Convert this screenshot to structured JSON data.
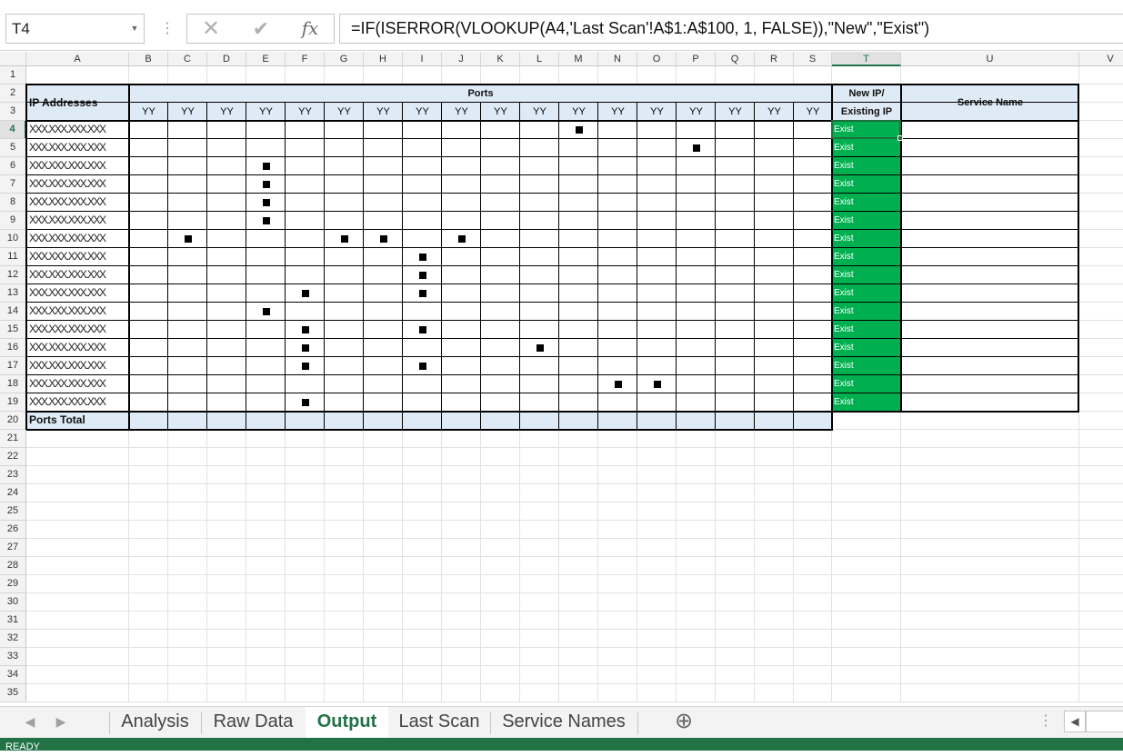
{
  "formula_bar": {
    "name_box": "T4",
    "formula": "=IF(ISERROR(VLOOKUP(A4,'Last Scan'!A$1:A$100, 1, FALSE)),\"New\",\"Exist\")",
    "cancel_icon": "close-icon",
    "enter_icon": "check-icon",
    "fx_label": "fx"
  },
  "columns": [
    "A",
    "B",
    "C",
    "D",
    "E",
    "F",
    "G",
    "H",
    "I",
    "J",
    "K",
    "L",
    "M",
    "N",
    "O",
    "P",
    "Q",
    "R",
    "S",
    "T",
    "U",
    "V"
  ],
  "rows": [
    "1",
    "2",
    "3",
    "4",
    "5",
    "6",
    "7",
    "8",
    "9",
    "10",
    "11",
    "12",
    "13",
    "14",
    "15",
    "16",
    "17",
    "18",
    "19",
    "20",
    "21",
    "22",
    "23",
    "24",
    "25",
    "26",
    "27",
    "28",
    "29",
    "30",
    "31",
    "32",
    "33",
    "34",
    "35"
  ],
  "selected_cell": "T4",
  "sheet": {
    "ip_header": "IP Addresses",
    "ports_header": "Ports",
    "new_existing_header_line1": "New IP/",
    "new_existing_header_line2": "Existing IP",
    "service_header": "Service Name",
    "port_labels": [
      "YY",
      "YY",
      "YY",
      "YY",
      "YY",
      "YY",
      "YY",
      "YY",
      "YY",
      "YY",
      "YY",
      "YY",
      "YY",
      "YY",
      "YY",
      "YY",
      "YY",
      "YY"
    ],
    "ip_placeholder": "XXX.XXX.XXX.XXX",
    "data_rows": [
      {
        "row": 4,
        "ip": "XXX.XXX.XXX.XXX",
        "marks": [
          "M"
        ],
        "status": "Exist"
      },
      {
        "row": 5,
        "ip": "XXX.XXX.XXX.XXX",
        "marks": [
          "P"
        ],
        "status": "Exist"
      },
      {
        "row": 6,
        "ip": "XXX.XXX.XXX.XXX",
        "marks": [
          "E"
        ],
        "status": "Exist"
      },
      {
        "row": 7,
        "ip": "XXX.XXX.XXX.XXX",
        "marks": [
          "E"
        ],
        "status": "Exist"
      },
      {
        "row": 8,
        "ip": "XXX.XXX.XXX.XXX",
        "marks": [
          "E"
        ],
        "status": "Exist"
      },
      {
        "row": 9,
        "ip": "XXX.XXX.XXX.XXX",
        "marks": [
          "E"
        ],
        "status": "Exist"
      },
      {
        "row": 10,
        "ip": "XXX.XXX.XXX.XXX",
        "marks": [
          "C",
          "G",
          "H",
          "J"
        ],
        "status": "Exist"
      },
      {
        "row": 11,
        "ip": "XXX.XXX.XXX.XXX",
        "marks": [
          "I"
        ],
        "status": "Exist"
      },
      {
        "row": 12,
        "ip": "XXX.XXX.XXX.XXX",
        "marks": [
          "I"
        ],
        "status": "Exist"
      },
      {
        "row": 13,
        "ip": "XXX.XXX.XXX.XXX",
        "marks": [
          "F",
          "I"
        ],
        "status": "Exist"
      },
      {
        "row": 14,
        "ip": "XXX.XXX.XXX.XXX",
        "marks": [
          "E"
        ],
        "status": "Exist"
      },
      {
        "row": 15,
        "ip": "XXX.XXX.XXX.XXX",
        "marks": [
          "F",
          "I"
        ],
        "status": "Exist"
      },
      {
        "row": 16,
        "ip": "XXX.XXX.XXX.XXX",
        "marks": [
          "F",
          "L"
        ],
        "status": "Exist"
      },
      {
        "row": 17,
        "ip": "XXX.XXX.XXX.XXX",
        "marks": [
          "F",
          "I"
        ],
        "status": "Exist"
      },
      {
        "row": 18,
        "ip": "XXX.XXX.XXX.XXX",
        "marks": [
          "N",
          "O"
        ],
        "status": "Exist"
      },
      {
        "row": 19,
        "ip": "XXX.XXX.XXX.XXX",
        "marks": [
          "F"
        ],
        "status": "Exist"
      }
    ],
    "total_label": "Ports Total"
  },
  "tabs": [
    {
      "label": "Analysis",
      "active": false
    },
    {
      "label": "Raw Data",
      "active": false
    },
    {
      "label": "Output",
      "active": true
    },
    {
      "label": "Last Scan",
      "active": false
    },
    {
      "label": "Service Names",
      "active": false
    }
  ],
  "add_sheet_icon": "plus-circle-icon",
  "status": "READY",
  "colors": {
    "accent": "#217346",
    "exist_fill": "#00b050",
    "header_fill": "#deeaf6"
  }
}
